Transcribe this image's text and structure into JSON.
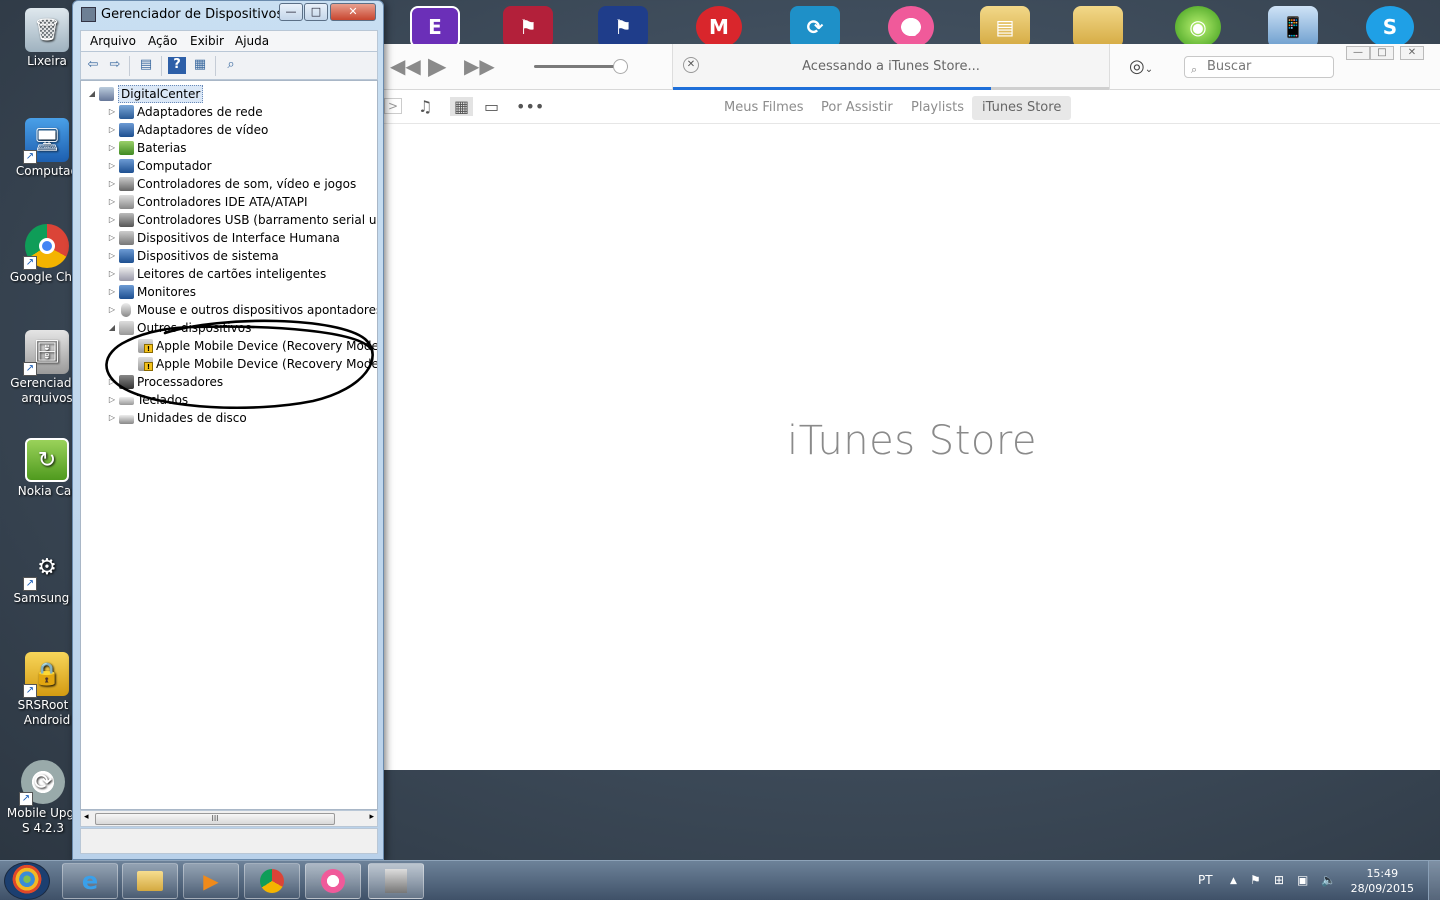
{
  "desktop": {
    "icons": [
      {
        "label": "Lixeira",
        "icon": "recycle-bin-icon"
      },
      {
        "label": "Computad",
        "icon": "computer-icon"
      },
      {
        "label": "Google Chro",
        "icon": "chrome-icon"
      },
      {
        "label": "Gerenciador",
        "label2": "arquivos",
        "icon": "file-manager-icon"
      },
      {
        "label": "Nokia Car",
        "icon": "nokia-icon"
      },
      {
        "label": "Samsung T",
        "icon": "gear-shield-icon"
      },
      {
        "label": "SRSRoot f",
        "label2": "Android",
        "icon": "lock-icon"
      },
      {
        "label": "Mobile Upgr",
        "label2": "S 4.2.3",
        "icon": "update-icon"
      }
    ],
    "top_icons": [
      "app-e-icon",
      "flag-app-icon",
      "flag-app-2-icon",
      "motorola-icon",
      "refresh-app-icon",
      "itunes-icon",
      "folder-doc-icon",
      "folder-icon",
      "globe-icon",
      "phone-globe-icon",
      "skype-icon"
    ]
  },
  "devmgr": {
    "title": "Gerenciador de Dispositivos",
    "menu": [
      "Arquivo",
      "Ação",
      "Exibir",
      "Ajuda"
    ],
    "controls": {
      "minimize": "—",
      "maximize": "□",
      "close": "✕"
    },
    "tree": {
      "root": "DigitalCenter",
      "categories": [
        "Adaptadores de rede",
        "Adaptadores de vídeo",
        "Baterias",
        "Computador",
        "Controladores de som, vídeo e jogos",
        "Controladores IDE ATA/ATAPI",
        "Controladores USB (barramento serial unive",
        "Dispositivos de Interface Humana",
        "Dispositivos de sistema",
        "Leitores de cartões inteligentes",
        "Monitores",
        "Mouse e outros dispositivos apontadores",
        "Outros dispositivos"
      ],
      "other_devices": [
        "Apple Mobile Device (Recovery Mode)",
        "Apple Mobile Device (Recovery Mode)"
      ],
      "after": [
        "Processadores",
        "Teclados",
        "Unidades de disco"
      ]
    },
    "scroll_thumb": "III"
  },
  "itunes": {
    "lcd_status": "Acessando a iTunes Store...",
    "lcd_progress": 0.73,
    "search_placeholder": "Buscar",
    "volume_level": 0.92,
    "tabs": [
      "Meus Filmes",
      "Por Assistir",
      "Playlists",
      "iTunes Store"
    ],
    "active_tab": "iTunes Store",
    "store_title": "iTunes Store"
  },
  "taskbar": {
    "tasks": [
      "ie-icon",
      "explorer-icon",
      "media-player-icon",
      "chrome-icon",
      "itunes-icon",
      "device-manager-icon"
    ],
    "language": "PT",
    "time": "15:49",
    "date": "28/09/2015"
  }
}
